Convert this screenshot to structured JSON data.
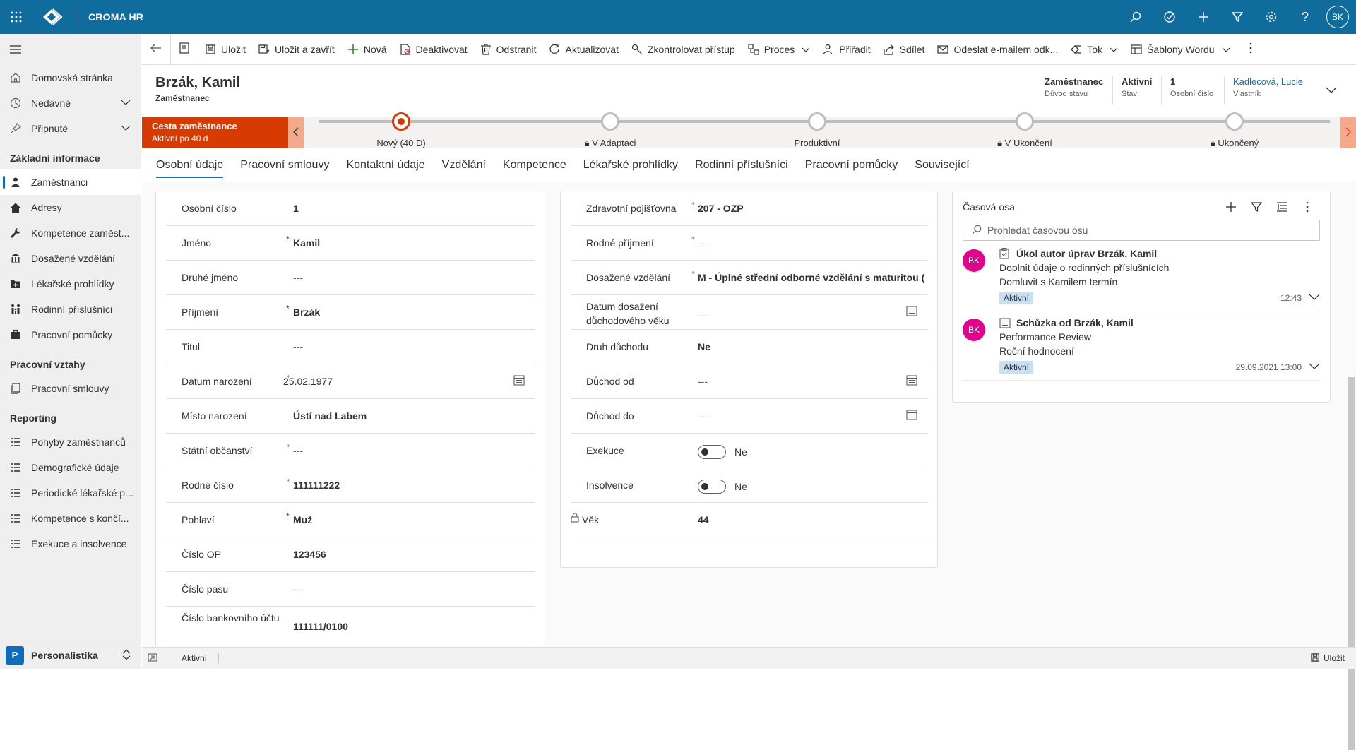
{
  "topbar": {
    "app_name": "CROMA HR",
    "avatar_initials": "BK"
  },
  "sidebar": {
    "top_items": [
      {
        "label": "Domovská stránka",
        "icon": "home-icon"
      },
      {
        "label": "Nedávné",
        "icon": "clock-icon"
      },
      {
        "label": "Připnuté",
        "icon": "pin-icon"
      }
    ],
    "sections": [
      {
        "title": "Základní informace",
        "items": [
          "Zaměstnanci",
          "Adresy",
          "Kompetence zaměst...",
          "Dosažené vzdělání",
          "Lékařské prohlídky",
          "Rodinní příslušníci",
          "Pracovní pomůcky"
        ]
      },
      {
        "title": "Pracovní vztahy",
        "items": [
          "Pracovní smlouvy"
        ]
      },
      {
        "title": "Reporting",
        "items": [
          "Pohyby zaměstnanců",
          "Demografické údaje",
          "Periodické lékařské p...",
          "Kompetence s končí...",
          "Exekuce a insolvence"
        ]
      }
    ],
    "area_badge": "P",
    "area_label": "Personalistika"
  },
  "commands": [
    "Uložit",
    "Uložit a zavřít",
    "Nová",
    "Deaktivovat",
    "Odstranit",
    "Aktualizovat",
    "Zkontrolovat přístup",
    "Proces",
    "Přiřadit",
    "Sdílet",
    "Odeslat e-mailem odk...",
    "Tok",
    "Šablony Wordu"
  ],
  "header": {
    "name": "Brzák, Kamil",
    "entity": "Zaměstnanec",
    "fields": [
      {
        "value": "Zaměstnanec",
        "label": "Důvod stavu"
      },
      {
        "value": "Aktivní",
        "label": "Stav"
      },
      {
        "value": "1",
        "label": "Osobní číslo"
      },
      {
        "value": "Kadlecová, Lucie",
        "label": "Vlastník"
      }
    ]
  },
  "bpf": {
    "title": "Cesta zaměstnance",
    "subtitle": "Aktivní po 40 d",
    "stages": [
      "Nový  (40 D)",
      "V Adaptaci",
      "Produktivní",
      "V Ukončení",
      "Ukončený"
    ]
  },
  "tabs": [
    "Osobní údaje",
    "Pracovní smlouvy",
    "Kontaktní údaje",
    "Vzdělání",
    "Kompetence",
    "Lékařské prohlídky",
    "Rodinní příslušníci",
    "Pracovní pomůcky",
    "Související"
  ],
  "form_left": [
    {
      "label": "Osobní číslo",
      "value": "1"
    },
    {
      "label": "Jméno",
      "value": "Kamil"
    },
    {
      "label": "Druhé jméno",
      "value": "---"
    },
    {
      "label": "Příjmení",
      "value": "Brzák"
    },
    {
      "label": "Titul",
      "value": "---"
    },
    {
      "label": "Datum narození",
      "value": "25.02.1977"
    },
    {
      "label": "Místo narození",
      "value": "Ústí nad Labem"
    },
    {
      "label": "Státní občanství",
      "value": "---"
    },
    {
      "label": "Rodné číslo",
      "value": "111111222"
    },
    {
      "label": "Pohlaví",
      "value": "Muž"
    },
    {
      "label": "Číslo OP",
      "value": "123456"
    },
    {
      "label": "Číslo pasu",
      "value": "---"
    },
    {
      "label": "Číslo bankovního účtu",
      "value": "111111/0100"
    }
  ],
  "form_right": [
    {
      "label": "Zdravotní pojišťovna",
      "value": "207 - OZP"
    },
    {
      "label": "Rodné příjmení",
      "value": "---"
    },
    {
      "label": "Dosažené vzdělání",
      "value": "M - Úplné střední odborné vzdělání s maturitou (b"
    },
    {
      "label": "Datum dosažení důchodového věku",
      "value": "---"
    },
    {
      "label": "Druh důchodu",
      "value": "Ne"
    },
    {
      "label": "Důchod od",
      "value": "---"
    },
    {
      "label": "Důchod do",
      "value": "---"
    },
    {
      "label": "Exekuce",
      "value": "Ne"
    },
    {
      "label": "Insolvence",
      "value": "Ne"
    },
    {
      "label": "Věk",
      "value": "44"
    }
  ],
  "timeline": {
    "title": "Časová osa",
    "search_placeholder": "Prohledat časovou osu",
    "items": [
      {
        "avatar": "BK",
        "title": "Úkol autor úprav Brzák, Kamil",
        "line1": "Doplnit údaje o rodinných příslušnících",
        "line2": "Domluvit s Kamilem termín",
        "badge": "Aktivní",
        "time": "12:43"
      },
      {
        "avatar": "BK",
        "title": "Schůzka od Brzák, Kamil",
        "line1": "Performance Review",
        "line2": "Roční hodnocení",
        "badge": "Aktivní",
        "time": "29.09.2021 13:00"
      }
    ]
  },
  "status": {
    "state": "Aktivní",
    "save": "Uložit"
  }
}
